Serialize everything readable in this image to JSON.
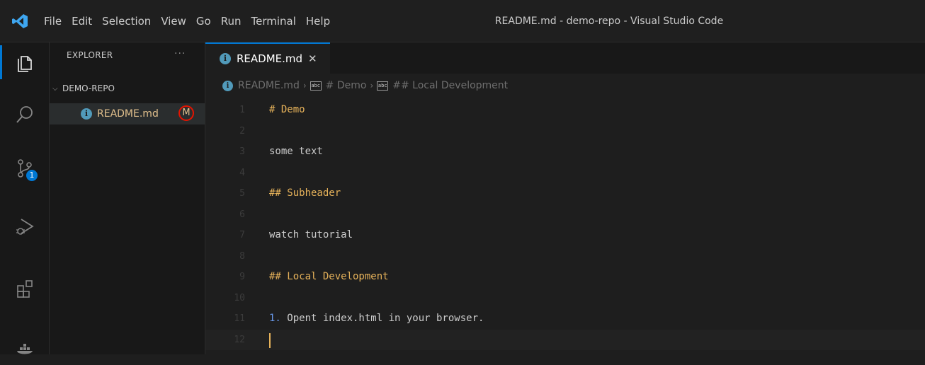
{
  "titlebar": {
    "menu": [
      "File",
      "Edit",
      "Selection",
      "View",
      "Go",
      "Run",
      "Terminal",
      "Help"
    ],
    "window_title": "README.md - demo-repo - Visual Studio Code"
  },
  "activitybar": {
    "items": [
      "explorer-icon",
      "search-icon",
      "source-control-icon",
      "run-debug-icon",
      "extensions-icon",
      "docker-icon"
    ],
    "source_control_badge": "1",
    "accent_color": "#0078d4"
  },
  "sidebar": {
    "header": "EXPLORER",
    "more": "···",
    "folder": "DEMO-REPO",
    "file": {
      "name": "README.md",
      "status": "M",
      "icon": "info-icon"
    }
  },
  "editor": {
    "tab": {
      "label": "README.md",
      "close": "✕"
    },
    "breadcrumb": [
      "README.md",
      "# Demo",
      "## Local Development"
    ],
    "lines": [
      {
        "n": "1",
        "text": "# Demo",
        "kind": "heading"
      },
      {
        "n": "2",
        "text": "",
        "kind": "plain"
      },
      {
        "n": "3",
        "text": "some text",
        "kind": "plain"
      },
      {
        "n": "4",
        "text": "",
        "kind": "plain"
      },
      {
        "n": "5",
        "text": "## Subheader",
        "kind": "heading"
      },
      {
        "n": "6",
        "text": "",
        "kind": "plain"
      },
      {
        "n": "7",
        "text": "watch tutorial",
        "kind": "plain"
      },
      {
        "n": "8",
        "text": "",
        "kind": "plain"
      },
      {
        "n": "9",
        "text": "## Local Development",
        "kind": "heading"
      },
      {
        "n": "10",
        "text": "",
        "kind": "plain"
      },
      {
        "n": "11",
        "list_num": "1.",
        "text": " Opent index.html in your browser.",
        "kind": "list"
      },
      {
        "n": "12",
        "text": "",
        "kind": "cursor"
      }
    ],
    "colors": {
      "heading": "#e6b25a",
      "list_number": "#6796e6",
      "modified": "#e2c08d",
      "highlight_circle": "#e51400"
    }
  }
}
